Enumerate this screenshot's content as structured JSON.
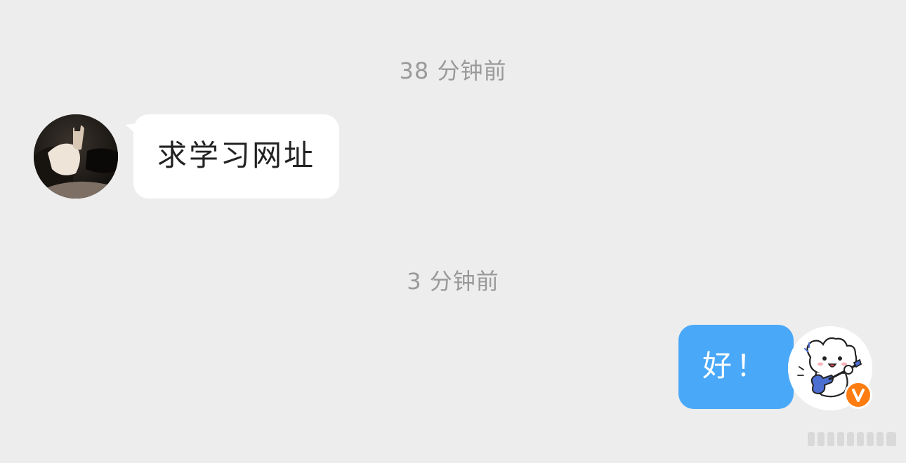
{
  "conversation": {
    "timestamps": [
      "38 分钟前",
      "3 分钟前"
    ],
    "messages": [
      {
        "side": "left",
        "text": "求学习网址"
      },
      {
        "side": "right",
        "text": "好！"
      }
    ]
  },
  "colors": {
    "background": "#ededed",
    "incoming_bubble": "#ffffff",
    "outgoing_bubble": "#4aa8f8",
    "timestamp_text": "#9a9a9a",
    "verified_badge": "#ff7d10"
  },
  "icons": {
    "left_avatar": "contact-photo-avatar",
    "right_avatar": "puppy-guitar-avatar",
    "badge": "verified-v-icon"
  }
}
